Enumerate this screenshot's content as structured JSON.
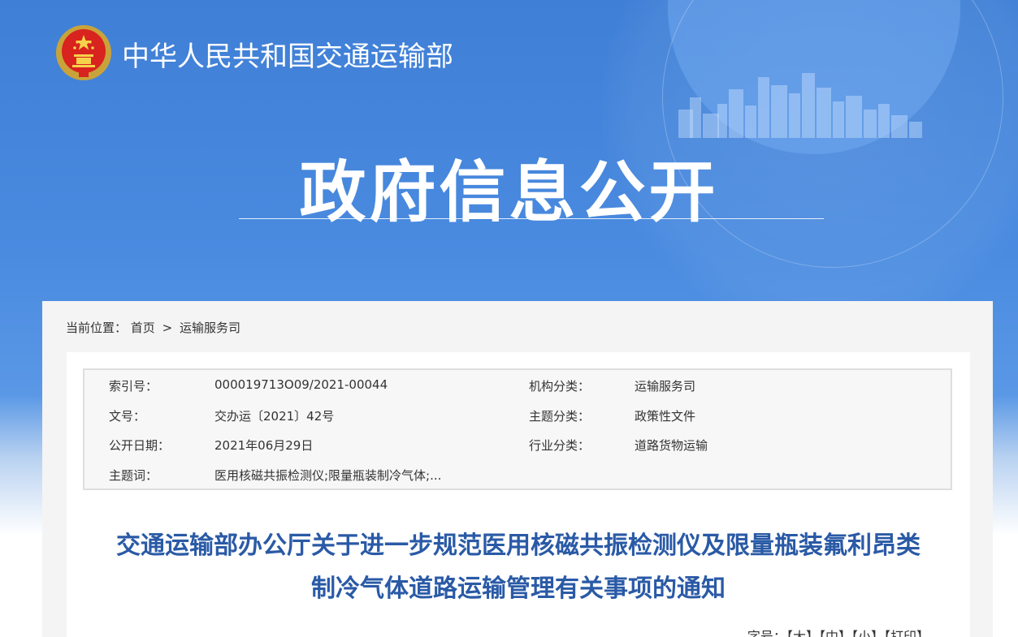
{
  "header": {
    "site_name": "中华人民共和国交通运输部",
    "banner_title": "政府信息公开"
  },
  "breadcrumb": {
    "prefix": "当前位置：",
    "items": [
      "首页",
      "运输服务司"
    ],
    "separator": ">"
  },
  "meta": {
    "index_label": "索引号：",
    "index_value": "000019713O09/2021-00044",
    "org_label": "机构分类：",
    "org_value": "运输服务司",
    "docno_label": "文号：",
    "docno_value": "交办运〔2021〕42号",
    "topic_label": "主题分类：",
    "topic_value": "政策性文件",
    "date_label": "公开日期：",
    "date_value": "2021年06月29日",
    "industry_label": "行业分类：",
    "industry_value": "道路货物运输",
    "keywords_label": "主题词：",
    "keywords_value": "医用核磁共振检测仪;限量瓶装制冷气体;..."
  },
  "document": {
    "title_line1": "交通运输部办公厅关于进一步规范医用核磁共振检测仪及限量瓶装氟利昂类",
    "title_line2": "制冷气体道路运输管理有关事项的通知"
  },
  "font_size_bar": {
    "label": "字号：",
    "large": "【大】",
    "medium": "【中】",
    "small": "【小】",
    "print": "【打印】"
  },
  "colors": {
    "banner_blue": "#4a8be0",
    "title_blue": "#2a5aa6"
  }
}
